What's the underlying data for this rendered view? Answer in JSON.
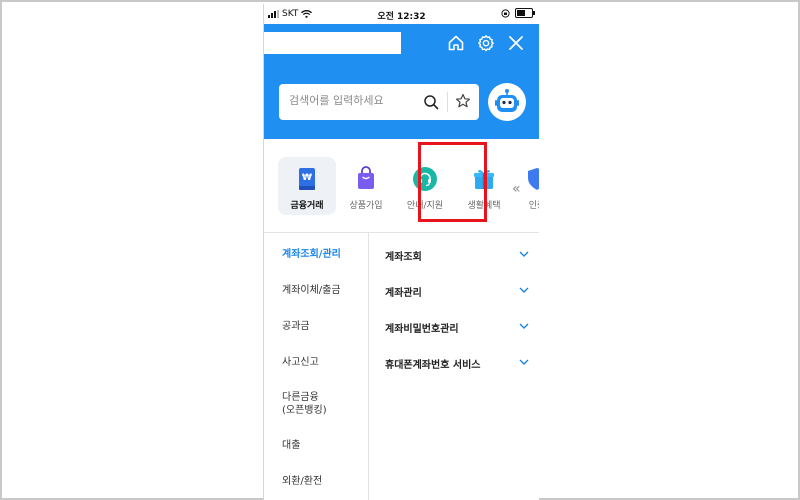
{
  "status_bar": {
    "carrier": "SKT",
    "time": "오전 12:32"
  },
  "header": {
    "icons": [
      "home-icon",
      "gear-icon",
      "close-icon"
    ],
    "search_placeholder": "검색어를 입력하세요",
    "search_icon": "search-icon",
    "favorite_icon": "star-icon",
    "chatbot_icon": "robot-icon",
    "accent_color": "#1f8ff2"
  },
  "categories": [
    {
      "label": "금융거래",
      "icon": "banking-doc-icon",
      "active": true
    },
    {
      "label": "상품가입",
      "icon": "shopping-bag-icon",
      "active": false
    },
    {
      "label": "안내/지원",
      "icon": "headset-icon",
      "active": false,
      "highlighted": true
    },
    {
      "label": "생활혜택",
      "icon": "gift-icon",
      "active": false
    },
    {
      "label": "인증",
      "icon": "shield-icon",
      "active": false
    }
  ],
  "left_menu": [
    {
      "label": "계좌조회/관리",
      "selected": true
    },
    {
      "label": "계좌이체/출금",
      "selected": false
    },
    {
      "label": "공과금",
      "selected": false
    },
    {
      "label": "사고신고",
      "selected": false
    },
    {
      "label": "다른금융\n(오픈뱅킹)",
      "selected": false
    },
    {
      "label": "대출",
      "selected": false
    },
    {
      "label": "외환/환전",
      "selected": false
    }
  ],
  "right_menu": [
    {
      "label": "계좌조회"
    },
    {
      "label": "계좌관리"
    },
    {
      "label": "계좌비밀번호관리"
    },
    {
      "label": "휴대폰계좌번호 서비스"
    }
  ],
  "colors": {
    "highlight_border": "#e8131b",
    "selected_text": "#1f86e8"
  }
}
